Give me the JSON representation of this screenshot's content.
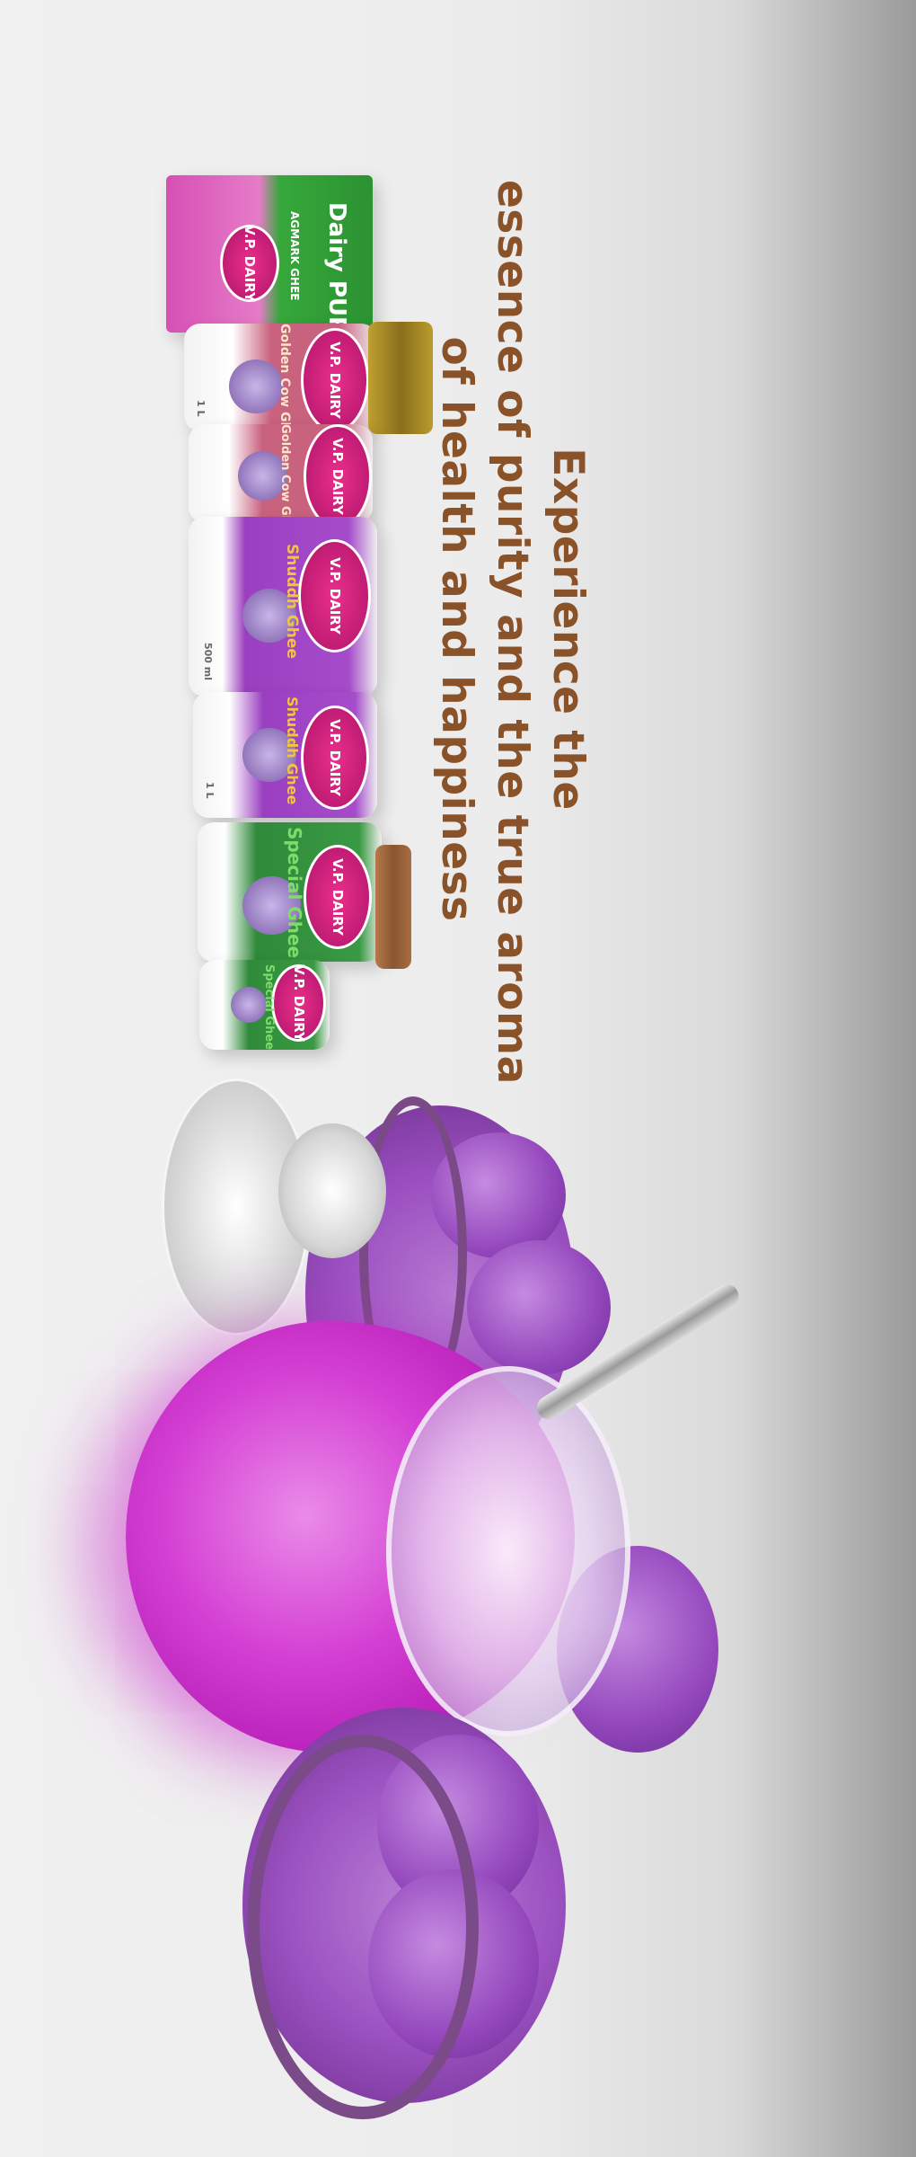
{
  "headline": {
    "line1": "Experience the",
    "line2": "essence of purity and the true aroma",
    "line3": "of health and happiness"
  },
  "products": [
    {
      "brand": "V.P. DAIRY",
      "name": "Dairy PURE",
      "sub": "AGMARK GHEE",
      "accent": "#3aa83a"
    },
    {
      "brand": "V.P. DAIRY",
      "name": "Golden Cow Ghee",
      "size": "1 L",
      "accent": "#c8507a"
    },
    {
      "brand": "V.P. DAIRY",
      "name": "Golden Cow Ghee",
      "accent": "#c8507a"
    },
    {
      "brand": "V.P. DAIRY",
      "name": "Shuddh Ghee",
      "size": "500 ml",
      "accent": "#9a3fc0"
    },
    {
      "brand": "V.P. DAIRY",
      "name": "Shuddh Ghee",
      "size": "1 L",
      "accent": "#9a3fc0"
    },
    {
      "brand": "V.P. DAIRY",
      "name": "Special Ghee",
      "accent": "#2f8a3a"
    },
    {
      "brand": "V.P. DAIRY",
      "name": "Special Ghee",
      "accent": "#2f8a3a"
    }
  ],
  "colors": {
    "headline": "#8a5228",
    "pot": "#d43fd3",
    "sweets": "#9a4fc0"
  }
}
